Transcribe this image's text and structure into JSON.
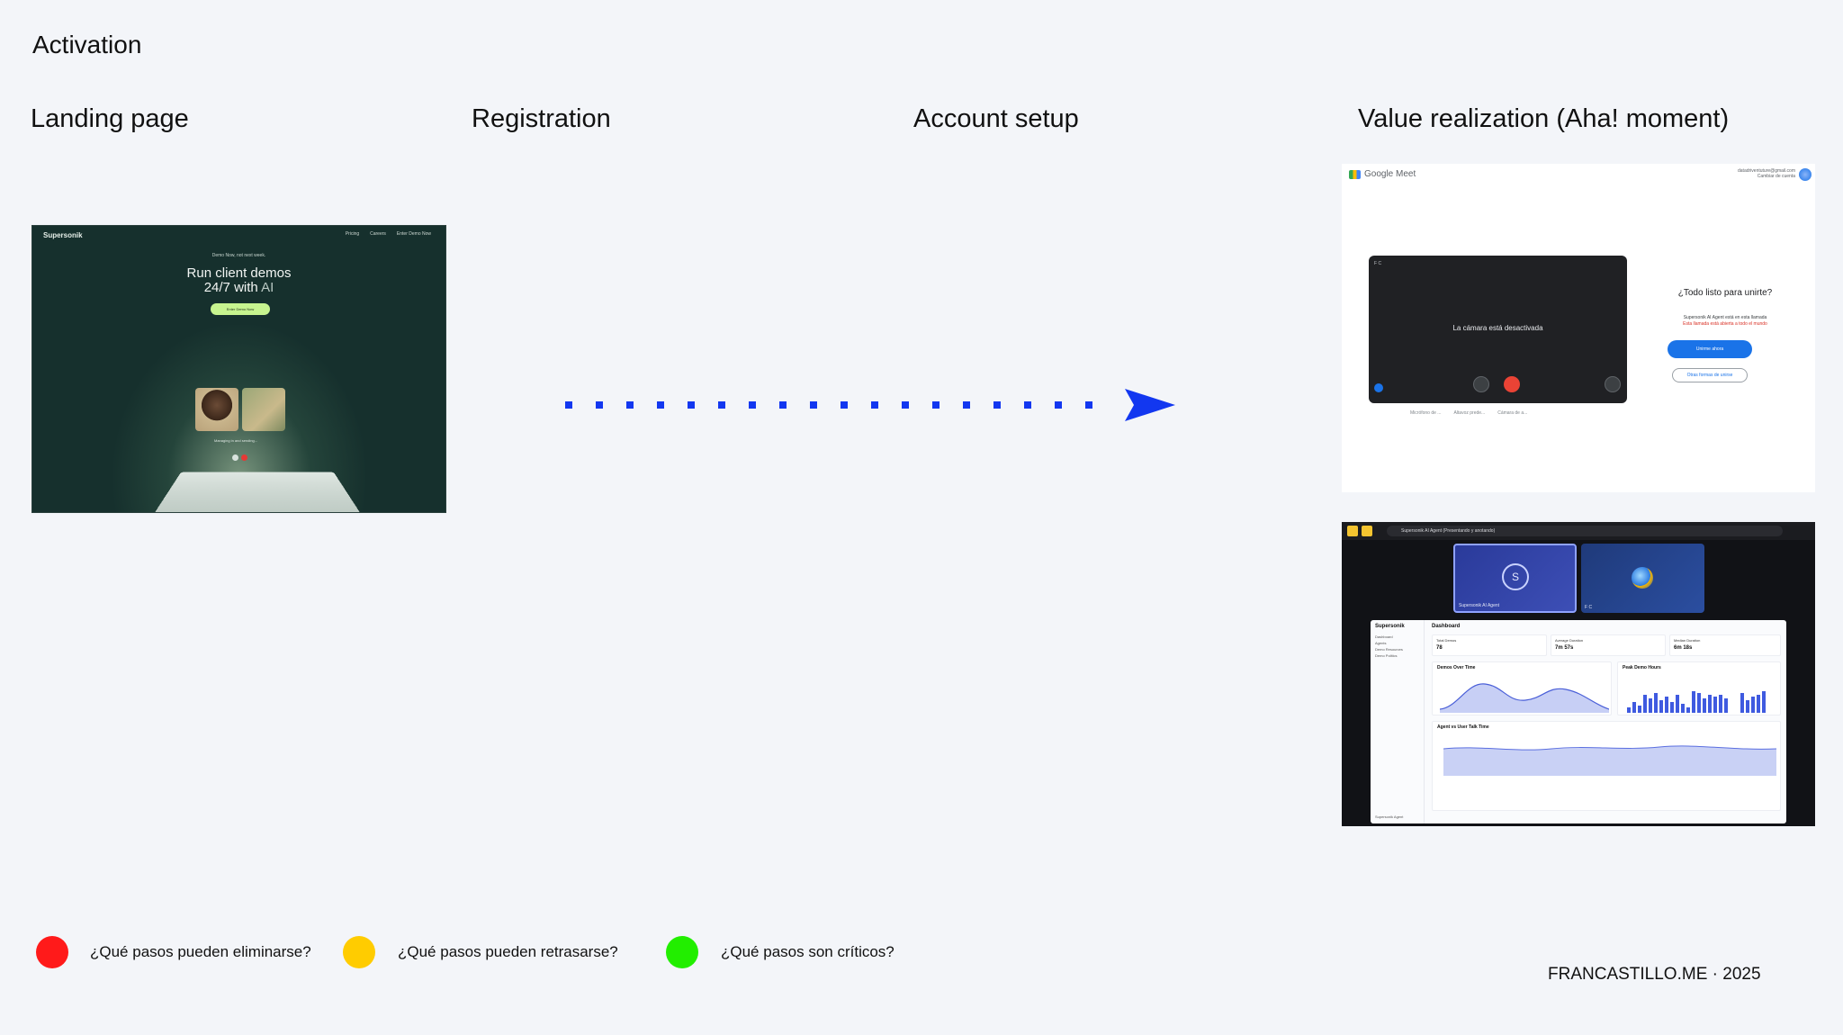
{
  "title": "Activation",
  "stages": [
    "Landing page",
    "Registration",
    "Account setup",
    "Value realization (Aha! moment)"
  ],
  "colors": {
    "background": "#f3f5f9",
    "arrow": "#1237f0",
    "eliminate": "#ff1a1a",
    "delay": "#ffcc00",
    "critical": "#22ee00"
  },
  "landing_screenshot": {
    "brand": "Supersonik",
    "nav": [
      "Pricing",
      "Careers",
      "Enter Demo Now"
    ],
    "kicker": "Demo Now, not next week.",
    "headline_line1": "Run client demos",
    "headline_line2_main": "24/7 with",
    "headline_line2_accent": "AI",
    "cta": "Enter Demo Now",
    "caption": "Managing in and sending..."
  },
  "meet_screenshot": {
    "app_name": "Google Meet",
    "account_email": "datadriventuture@gmail.com",
    "account_switch": "Cambiar de cuenta",
    "preview_initials": "F C",
    "camera_off": "La cámara está desactivada",
    "devices": [
      "Micrófono de ...",
      "Altavoz prede...",
      "Cámara de a..."
    ],
    "ready_question": "¿Todo listo para unirte?",
    "status_line": "Supersonik AI Agent está en esta llamada",
    "warning_line": "Esta llamada está abierta a todo el mundo",
    "join_button": "Unirme ahora",
    "other_ways": "Otras formas de unirse"
  },
  "dashboard_screenshot": {
    "presenting_banner": "Supersonik AI Agent (Presentando y anotando)",
    "tile1_initial": "S",
    "tile1_label": "Supersonik AI Agent",
    "tile2_label": "F C",
    "app_brand": "Supersonik",
    "page_title": "Dashboard",
    "sidebar_items": [
      "Dashboard",
      "Agents",
      "Demo Resources",
      "Demo Politics"
    ],
    "stats": [
      {
        "label": "Total Demos",
        "value": "78"
      },
      {
        "label": "Average Duration",
        "value": "7m 57s"
      },
      {
        "label": "Median Duration",
        "value": "6m 18s"
      }
    ],
    "chart1_title": "Demos Over Time",
    "chart2_title": "Peak Demo Hours",
    "chart3_title": "Agent vs User Talk Time",
    "user_label": "Supersonik Agent"
  },
  "legend": [
    {
      "text": "¿Qué pasos pueden eliminarse?",
      "color": "#ff1a1a"
    },
    {
      "text": "¿Qué pasos pueden retrasarse?",
      "color": "#ffcc00"
    },
    {
      "text": "¿Qué pasos son críticos?",
      "color": "#22ee00"
    }
  ],
  "footer": "FRANCASTILLO.ME · 2025"
}
